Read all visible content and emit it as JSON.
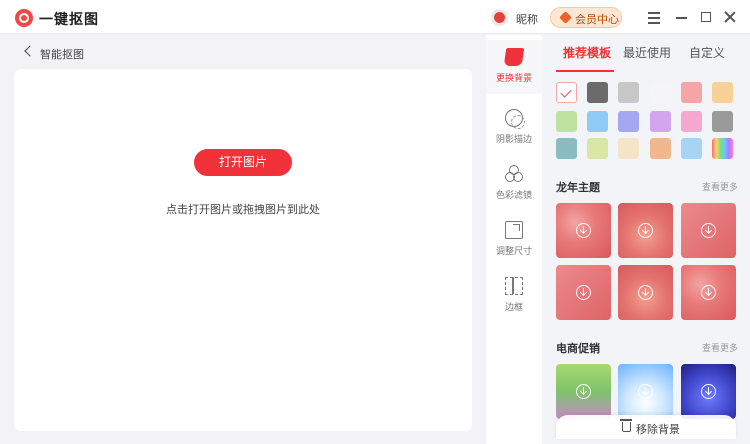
{
  "app": {
    "title": "一键抠图"
  },
  "header": {
    "nickname": "昵称",
    "vip_label": "会员中心"
  },
  "nav": {
    "back_label": "智能抠图"
  },
  "canvas": {
    "open_button": "打开图片",
    "hint": "点击打开图片或拖拽图片到此处"
  },
  "tools": [
    {
      "label": "更换背景",
      "icon": "paint-bucket-icon"
    },
    {
      "label": "阴影描边",
      "icon": "shadow-outline-icon"
    },
    {
      "label": "色彩滤镜",
      "icon": "color-filter-icon"
    },
    {
      "label": "调整尺寸",
      "icon": "resize-icon"
    },
    {
      "label": "边框",
      "icon": "border-icon"
    }
  ],
  "panel": {
    "tabs": [
      "推荐模板",
      "最近使用",
      "自定义"
    ],
    "active_tab": "推荐模板",
    "swatches": [
      "none",
      "#6b6b6b",
      "#c7c7c7",
      "#f5f5f7",
      "#f7a4a4",
      "#f8d198",
      "#bfe2a0",
      "#8fcbf5",
      "#a6a7f3",
      "#d2a6ee",
      "#f5a8d0",
      "#9a9a9a",
      "#8bbcc0",
      "#d8e7a6",
      "#f6e4c8",
      "#efb88e",
      "#a7d4f4",
      "rainbow"
    ],
    "sections": [
      {
        "title": "龙年主题",
        "more": "查看更多"
      },
      {
        "title": "电商促销",
        "more": "查看更多"
      }
    ],
    "remove_bg_label": "移除背景"
  },
  "colors": {
    "accent": "#f2323b",
    "vip_bg": "#fde7d3"
  }
}
